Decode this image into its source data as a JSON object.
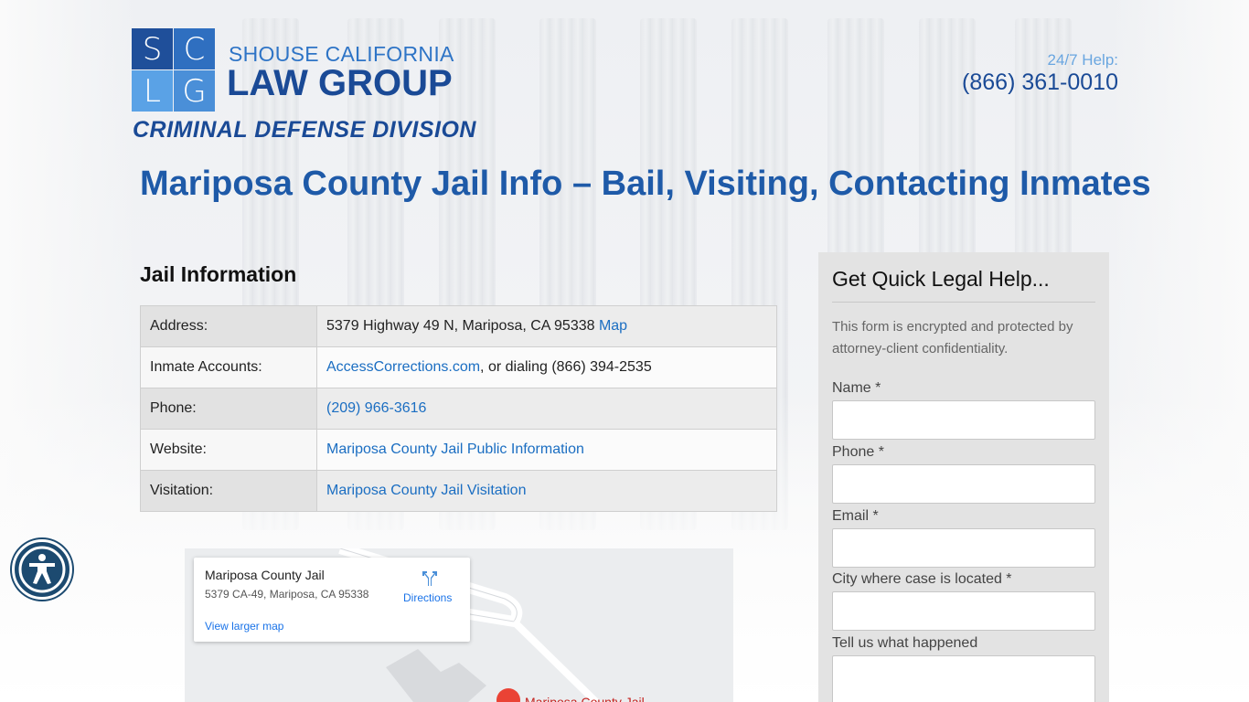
{
  "logo": {
    "letters": [
      "S",
      "C",
      "L",
      "G"
    ],
    "line1": "SHOUSE CALIFORNIA",
    "line2": "LAW GROUP",
    "division": "CRIMINAL DEFENSE DIVISION"
  },
  "help": {
    "label": "24/7 Help:",
    "phone": "(866) 361-0010"
  },
  "page_title": "Mariposa County Jail Info – Bail, Visiting, Contacting Inmates",
  "jail_info": {
    "heading": "Jail Information",
    "rows": [
      {
        "key": "Address:",
        "value": "5379 Highway 49 N, Mariposa, CA 95338 ",
        "link": "Map",
        "suffix": ""
      },
      {
        "key": "Inmate Accounts:",
        "value": "",
        "link": "AccessCorrections.com",
        "suffix": ", or dialing (866) 394-2535"
      },
      {
        "key": "Phone:",
        "value": "",
        "link": "(209) 966-3616",
        "suffix": ""
      },
      {
        "key": "Website:",
        "value": "",
        "link": "Mariposa County Jail Public Information",
        "suffix": ""
      },
      {
        "key": "Visitation:",
        "value": "",
        "link": "Mariposa County Jail Visitation",
        "suffix": ""
      }
    ]
  },
  "map": {
    "place_name": "Mariposa County Jail",
    "address": "5379 CA-49, Mariposa, CA 95338",
    "directions_label": "Directions",
    "larger_map_label": "View larger map",
    "pin_label": "Mariposa County Jail"
  },
  "form": {
    "title": "Get Quick Legal Help...",
    "note": "This form is encrypted and protected by attorney-client confidentiality.",
    "fields": {
      "name": "Name *",
      "phone": "Phone *",
      "email": "Email *",
      "city": "City where case is located *",
      "story": "Tell us what happened"
    }
  },
  "accessibility": {
    "icon": "accessibility-icon"
  },
  "colors": {
    "brand_dark": "#1a4a96",
    "brand_light": "#2e74c6",
    "link": "#1b6ec2"
  }
}
